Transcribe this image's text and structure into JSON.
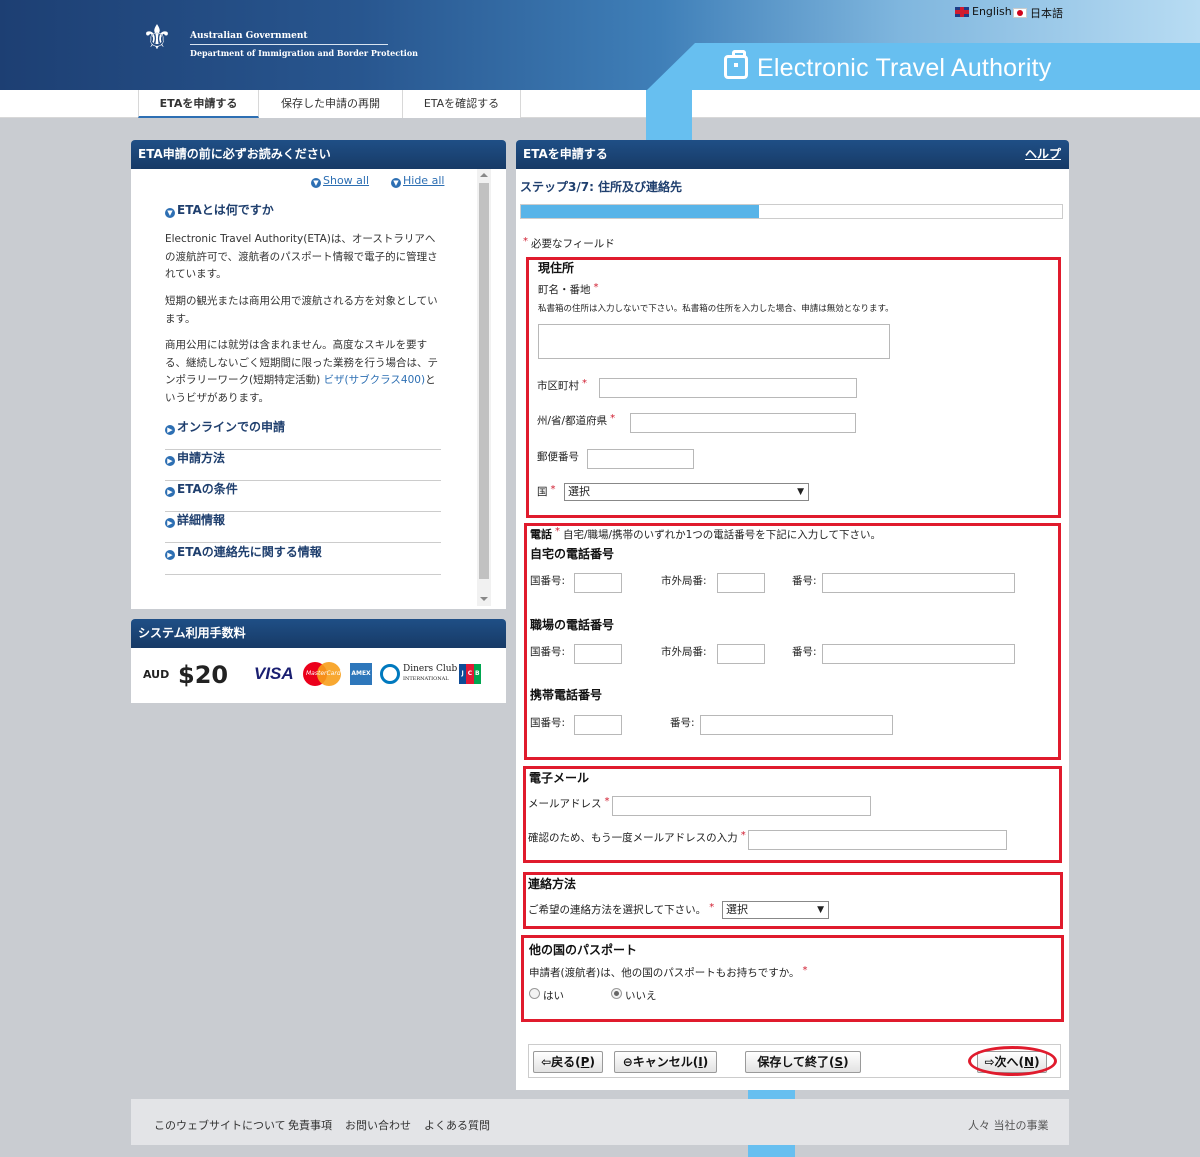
{
  "header": {
    "gov_line1": "Australian Government",
    "gov_line2": "Department of Immigration and Border Protection",
    "eta_title": "Electronic Travel Authority",
    "lang_en": "English",
    "lang_ja": "日本語"
  },
  "nav": {
    "tabs": [
      {
        "label": "ETAを申請する"
      },
      {
        "label": "保存した申請の再開"
      },
      {
        "label": "ETAを確認する"
      }
    ]
  },
  "left_panel": {
    "title": "ETA申請の前に必ずお読みください",
    "show_all": "Show all",
    "hide_all": "Hide all",
    "about_title": "ETAとは何ですか",
    "about_p1": "Electronic Travel Authority(ETA)は、オーストラリアへの渡航許可で、渡航者のパスポート情報で電子的に管理されています。",
    "about_p2": "短期の観光または商用公用で渡航される方を対象としています。",
    "about_p3_before": "商用公用には就労は含まれません。高度なスキルを要する、継続しないごく短期間に限った業務を行う場合は、テンポラリーワーク(短期特定活動) ",
    "about_p3_link": "ビザ(サブクラス400)",
    "about_p3_after": "というビザがあります。",
    "accordion": [
      {
        "label": "オンラインでの申請"
      },
      {
        "label": "申請方法"
      },
      {
        "label": "ETAの条件"
      },
      {
        "label": "詳細情報"
      },
      {
        "label": "ETAの連絡先に関する情報"
      }
    ]
  },
  "fee_panel": {
    "title": "システム利用手数料",
    "currency": "AUD",
    "amount": "$20",
    "cards": [
      "VISA",
      "MasterCard",
      "American Express",
      "Diners Club International",
      "JCB"
    ],
    "visa_text": "VISA",
    "mc_text": "MasterCard",
    "amex_text": "AMERICAN EXPRESS",
    "diners_text1": "Diners Club",
    "diners_text2": "INTERNATIONAL",
    "jcb_text": "JCB"
  },
  "main_panel": {
    "title": "ETAを申請する",
    "help": "ヘルプ",
    "step_title": "ステップ3/7: 住所及び連絡先",
    "progress_fraction": 0.44,
    "required_note": "必要なフィールド",
    "required_mark": "*"
  },
  "address": {
    "title": "現住所",
    "street_label": "町名・番地",
    "street_note": "私書箱の住所は入力しないで下さい。私書箱の住所を入力した場合、申請は無効となります。",
    "street_value": "",
    "city_label": "市区町村",
    "city_value": "",
    "state_label": "州/省/都道府県",
    "state_value": "",
    "postcode_label": "郵便番号",
    "postcode_value": "",
    "country_label": "国",
    "country_value": "選択"
  },
  "phone": {
    "title": "電話",
    "note": "自宅/職場/携帯のいずれか1つの電話番号を下記に入力して下さい。",
    "home_title": "自宅の電話番号",
    "work_title": "職場の電話番号",
    "mobile_title": "携帯電話番号",
    "country_code_label": "国番号:",
    "area_code_label": "市外局番:",
    "number_label": "番号:"
  },
  "email": {
    "title": "電子メール",
    "address_label": "メールアドレス",
    "confirm_label": "確認のため、もう一度メールアドレスの入力"
  },
  "contact": {
    "title": "連絡方法",
    "prompt": "ご希望の連絡方法を選択して下さい。",
    "value": "選択"
  },
  "passport": {
    "title": "他の国のパスポート",
    "question": "申請者(渡航者)は、他の国のパスポートもお持ちですか。",
    "yes": "はい",
    "no": "いいえ",
    "selected": "no"
  },
  "buttons": {
    "back_label": "戻る(",
    "back_key": "P",
    "cancel_label": "キャンセル(",
    "cancel_key": "I",
    "save_label": "保存して終了(",
    "save_key": "S",
    "next_label": "次へ(",
    "next_key": "N",
    "close_paren": ")"
  },
  "footer": {
    "links": [
      {
        "label": "このウェブサイトについて"
      },
      {
        "label": "免責事項"
      },
      {
        "label": "お問い合わせ"
      },
      {
        "label": "よくある質問"
      }
    ],
    "right_text": "人々 当社の事業"
  },
  "colors": {
    "header_dark": "#1d3f73",
    "accent_blue": "#67bff0",
    "panel_head": "#1f4f86",
    "highlight_red": "#e01b2d",
    "required_red": "#d01c2f",
    "progress_fill": "#58b4e8"
  }
}
